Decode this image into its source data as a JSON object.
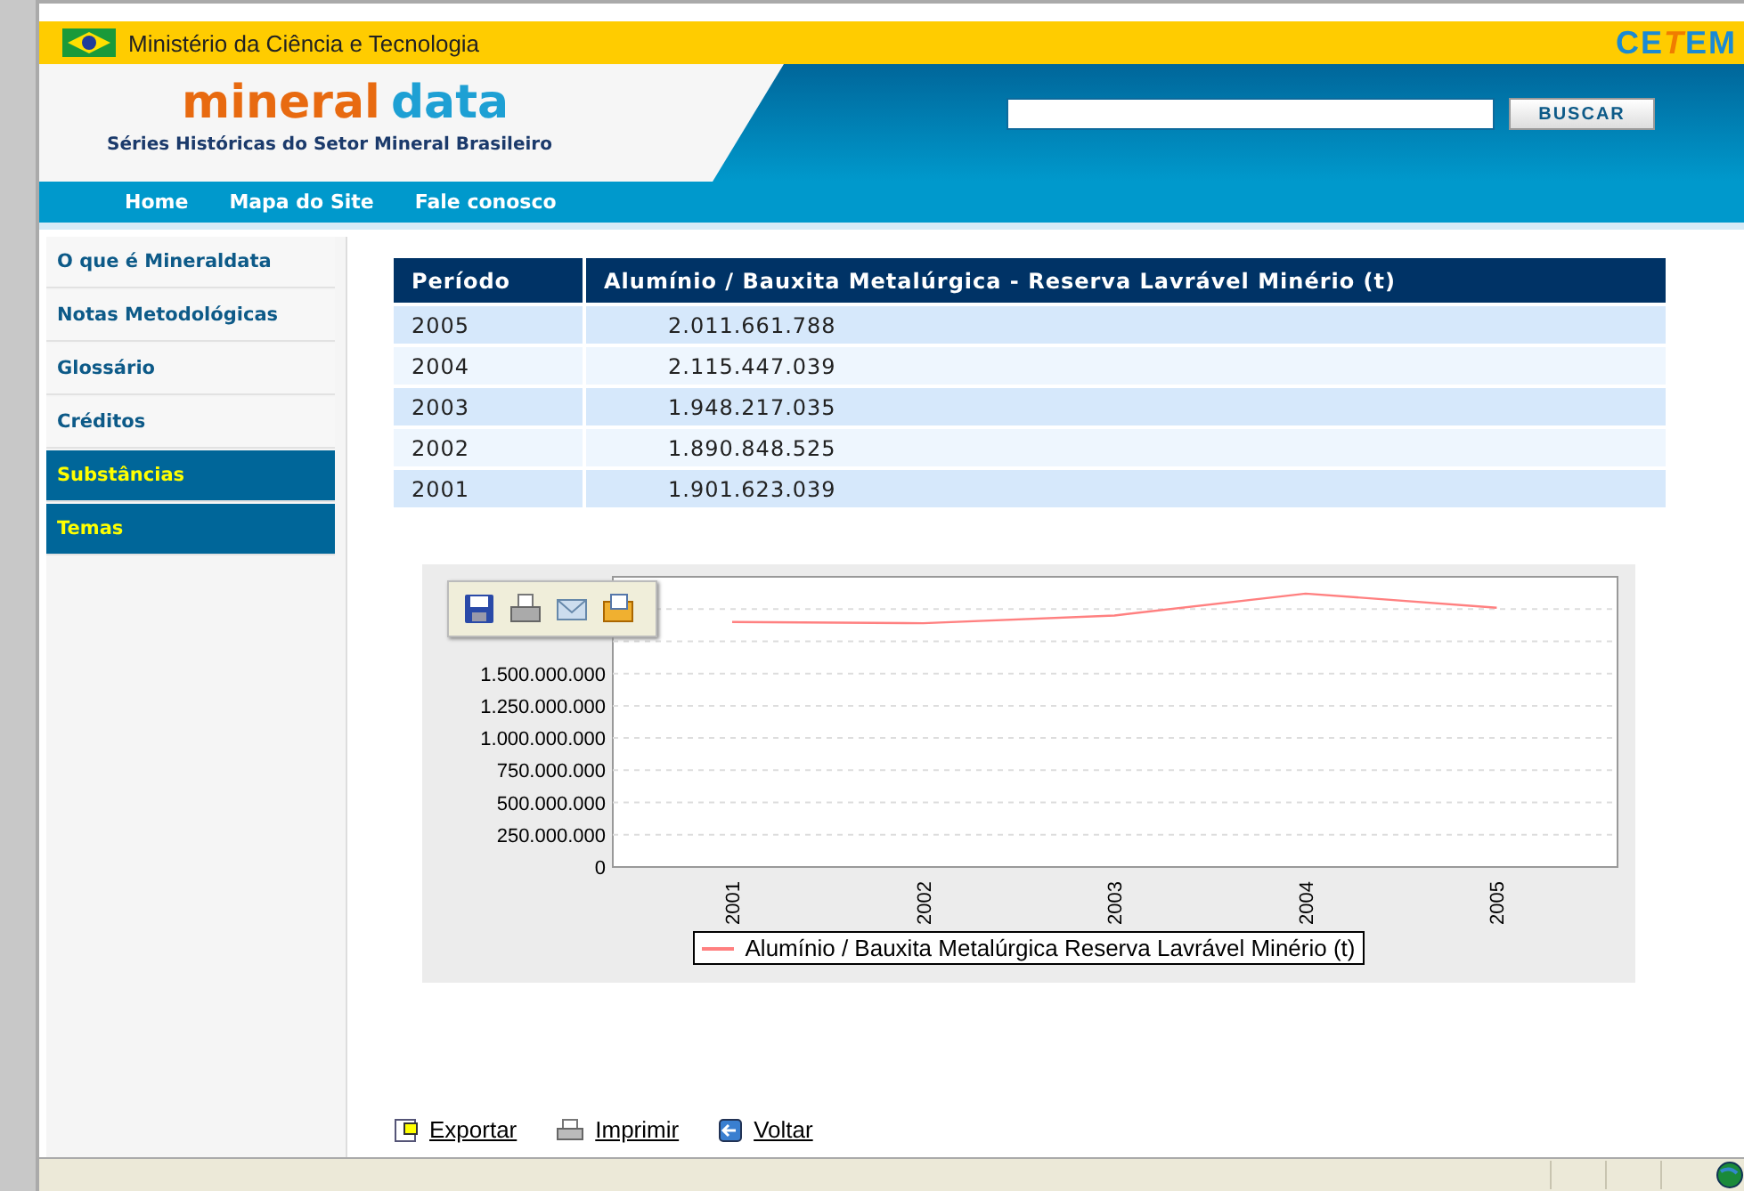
{
  "topbar": {
    "ministry": "Ministério da Ciência e Tecnologia",
    "brand": [
      "CE",
      "T",
      "EM"
    ]
  },
  "header": {
    "logo": [
      "mineral",
      "data"
    ],
    "tagline": "Séries Históricas do Setor Mineral Brasileiro",
    "search": {
      "button": "BUSCAR"
    }
  },
  "nav": [
    "Home",
    "Mapa do Site",
    "Fale conosco"
  ],
  "sidebar": [
    {
      "label": "O que é Mineraldata",
      "kind": "link"
    },
    {
      "label": "Notas Metodológicas",
      "kind": "link"
    },
    {
      "label": "Glossário",
      "kind": "link"
    },
    {
      "label": "Créditos",
      "kind": "link"
    },
    {
      "label": "Substâncias",
      "kind": "section"
    },
    {
      "label": "Temas",
      "kind": "section"
    }
  ],
  "table": {
    "columns": [
      "Período",
      "Alumínio / Bauxita Metalúrgica - Reserva Lavrável Minério (t)"
    ],
    "rows": [
      [
        "2005",
        "2.011.661.788"
      ],
      [
        "2004",
        "2.115.447.039"
      ],
      [
        "2003",
        "1.948.217.035"
      ],
      [
        "2002",
        "1.890.848.525"
      ],
      [
        "2001",
        "1.901.623.039"
      ]
    ]
  },
  "chart": {
    "chart_data": {
      "type": "line",
      "categories": [
        "2001",
        "2002",
        "2003",
        "2004",
        "2005"
      ],
      "series": [
        {
          "name": "Alumínio / Bauxita Metalúrgica Reserva Lavrável Minério (t)",
          "color": "#ff8080",
          "values": [
            1900000000,
            1890000000,
            1950000000,
            2120000000,
            2010000000
          ]
        }
      ],
      "grid": true,
      "ylim": [
        0,
        2250000000
      ],
      "yticks": [
        {
          "value": 0,
          "label": "0"
        },
        {
          "value": 250000000,
          "label": "250.000.000"
        },
        {
          "value": 500000000,
          "label": "500.000.000"
        },
        {
          "value": 750000000,
          "label": "750.000.000"
        },
        {
          "value": 1000000000,
          "label": "1.000.000.000"
        },
        {
          "value": 1250000000,
          "label": "1.250.000.000"
        },
        {
          "value": 1500000000,
          "label": "1.500.000.000"
        }
      ]
    }
  },
  "footer_links": [
    {
      "label": "Exportar",
      "kind": "export"
    },
    {
      "label": "Imprimir",
      "kind": "print"
    },
    {
      "label": "Voltar",
      "kind": "back"
    }
  ]
}
